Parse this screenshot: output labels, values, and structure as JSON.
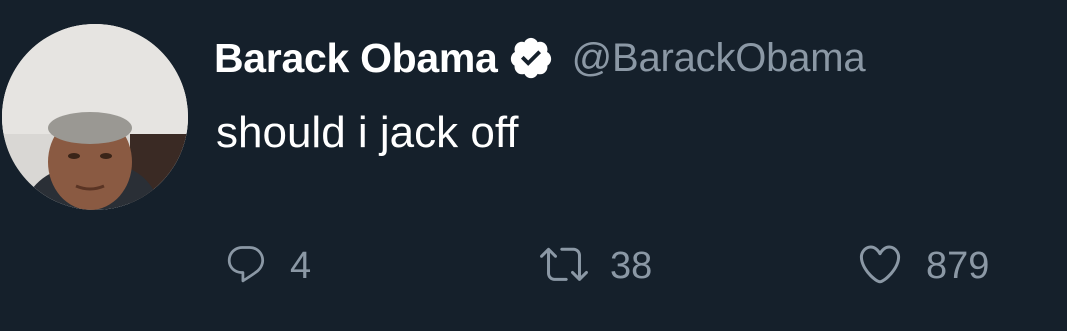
{
  "user": {
    "display_name": "Barack Obama",
    "handle": "@BarackObama",
    "verified": true
  },
  "tweet": {
    "text": "should i jack off"
  },
  "actions": {
    "reply_count": "4",
    "retweet_count": "38",
    "like_count": "879"
  },
  "icons": {
    "reply": "speech-bubble-icon",
    "retweet": "retweet-arrows-icon",
    "like": "heart-icon",
    "verified": "verified-badge-icon"
  },
  "colors": {
    "background": "#15202b",
    "primary_text": "#ffffff",
    "secondary_text": "#8b98a5"
  }
}
